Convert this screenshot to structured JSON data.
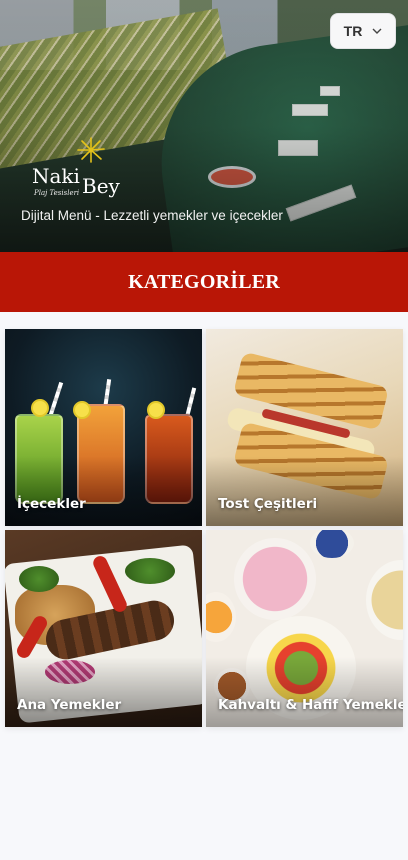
{
  "header": {
    "language_code": "TR",
    "brand_line1": "Naki",
    "brand_line2": "Bey",
    "brand_tagline": "Plaj Tesisleri",
    "subtitle": "Dijital Menü - Lezzetli yemekler ve içecekler"
  },
  "section": {
    "title": "KATEGORİLER"
  },
  "categories": [
    {
      "label": "İçecekler"
    },
    {
      "label": "Tost Çeşitleri"
    },
    {
      "label": "Ana Yemekler"
    },
    {
      "label": "Kahvaltı & Hafif Yemekler"
    }
  ],
  "colors": {
    "banner_red": "#b91606",
    "page_bg": "#f7f8fb",
    "logo_star": "#e5c21a"
  },
  "icons": {
    "language_dropdown": "chevron-down-icon",
    "logo_mark": "star-burst-icon"
  }
}
